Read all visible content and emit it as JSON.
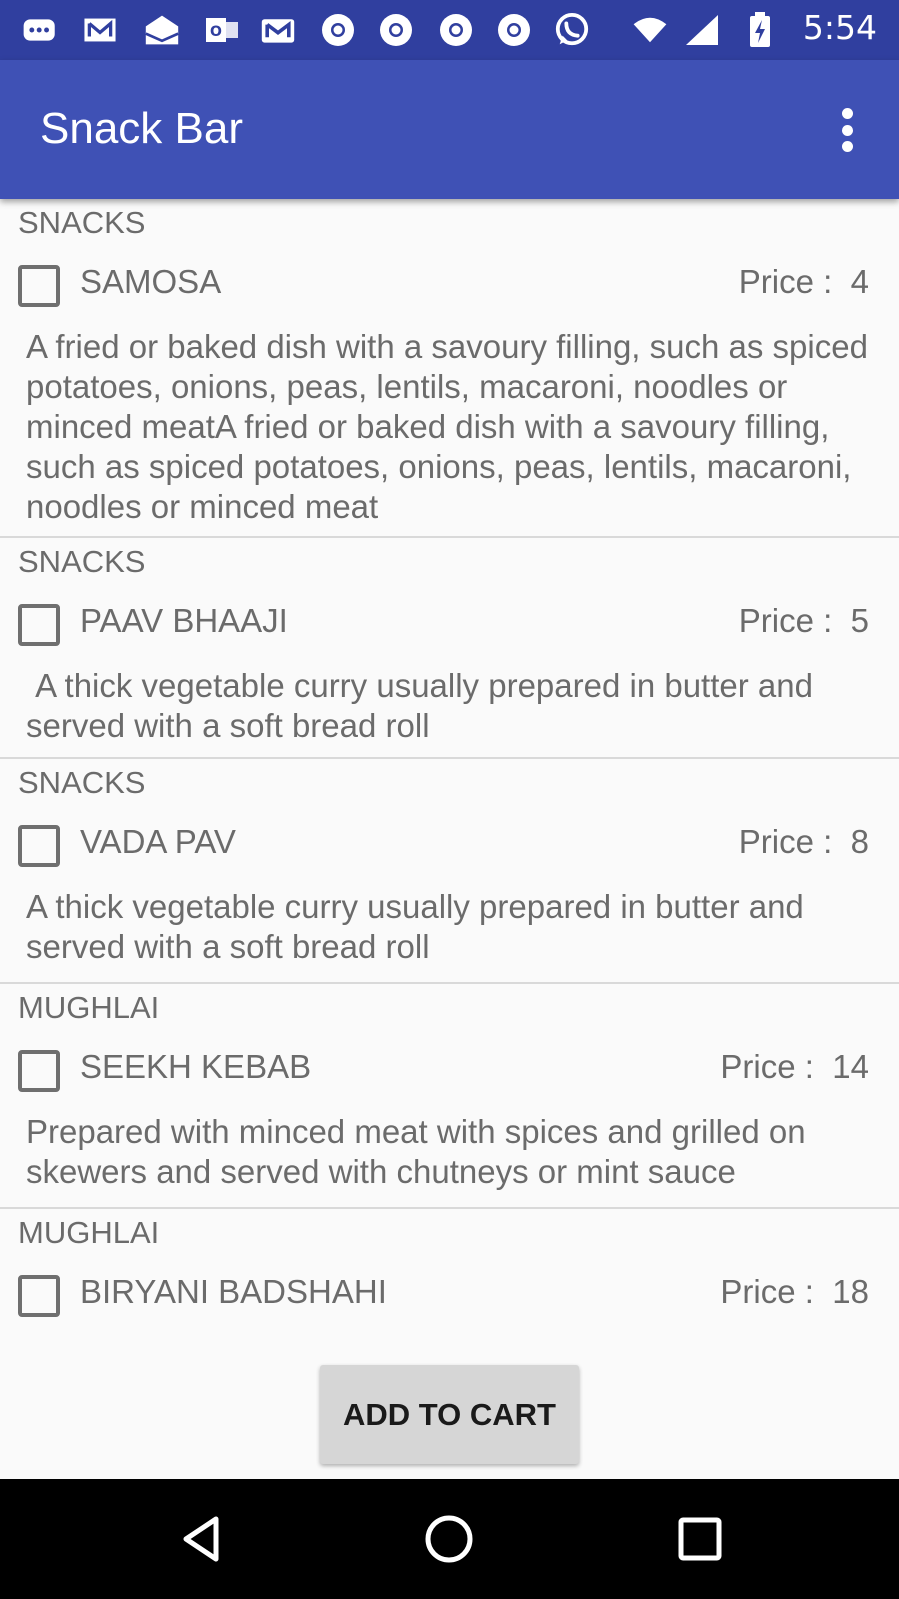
{
  "status_bar": {
    "time": "5:54",
    "icons": [
      "chat-icon",
      "mail-icon",
      "inbox-icon",
      "outlook-icon",
      "gmail-icon",
      "chrome-icon",
      "chrome-icon",
      "chrome-icon",
      "chrome-icon",
      "whatsapp-icon",
      "wifi-icon",
      "signal-icon",
      "battery-icon"
    ]
  },
  "app_bar": {
    "title": "Snack Bar",
    "menu_icon": "overflow-menu-icon",
    "background": "#3f51b5",
    "status_background": "#303f9f"
  },
  "items": [
    {
      "category": "SNACKS",
      "name": "SAMOSA",
      "price": "Price :  4",
      "description": "A fried or baked dish with a savoury filling, such as spiced potatoes, onions, peas, lentils, macaroni, noodles or minced meatA fried or baked dish with a savoury filling, such as spiced potatoes, onions, peas, lentils, macaroni, noodles or minced meat",
      "checked": false
    },
    {
      "category": "SNACKS",
      "name": "PAAV BHAAJI",
      "price": "Price :  5",
      "description": " A thick vegetable curry usually prepared in butter and served with a soft bread roll",
      "checked": false
    },
    {
      "category": "SNACKS",
      "name": "VADA PAV",
      "price": "Price :  8",
      "description": "A thick vegetable curry usually prepared in butter and served with a soft bread roll",
      "checked": false
    },
    {
      "category": "MUGHLAI",
      "name": "SEEKH KEBAB",
      "price": "Price :  14",
      "description": "Prepared with minced meat with spices and grilled on skewers and served with chutneys or mint sauce",
      "checked": false
    },
    {
      "category": "MUGHLAI",
      "name": "BIRYANI BADSHAHI",
      "price": "Price :  18",
      "description": "",
      "checked": false
    }
  ],
  "cart_button": {
    "label": "ADD TO CART"
  },
  "nav_bar": {
    "icons": [
      "back-icon",
      "home-icon",
      "recents-icon"
    ]
  }
}
